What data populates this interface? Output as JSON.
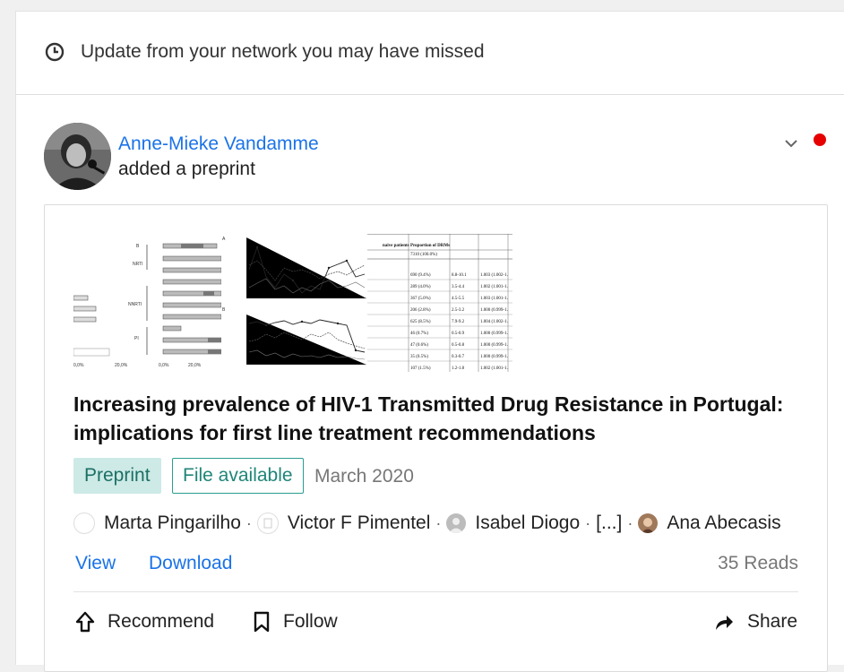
{
  "header": {
    "text": "Update from your network you may have missed",
    "icon": "clock-icon"
  },
  "post": {
    "author_name": "Anne-Mieke Vandamme",
    "action": "added a preprint",
    "unread_color": "#e60000"
  },
  "publication": {
    "title": "Increasing prevalence of HIV-1 Transmitted Drug Resistance in Portugal: implications for first line treatment recommendations",
    "type_badge": "Preprint",
    "file_badge": "File available",
    "date": "March 2020",
    "authors": [
      {
        "name": "Marta Pingarilho"
      },
      {
        "name": "Victor F Pimentel"
      },
      {
        "name": "Isabel Diogo"
      },
      {
        "name": "[...]"
      },
      {
        "name": "Ana Abecasis"
      }
    ],
    "view_label": "View",
    "download_label": "Download",
    "reads": "35 Reads"
  },
  "thumbnail_table": {
    "header": [
      "Proportion of DRMs"
    ],
    "rows": [
      [
        "7310 (100.0%)",
        "",
        ""
      ],
      [
        "690 (9.4%)",
        "8.8-10.1",
        "1.003 (1.002-1."
      ],
      [
        "289 (4.0%)",
        "3.5-4.4",
        "1.002 (1.001-1."
      ],
      [
        "367 (5.0%)",
        "4.5-5.5",
        "1.003 (1.001-1."
      ],
      [
        "206 (2.8%)",
        "2.5-3.2",
        "1.000 (0.999-1."
      ],
      [
        "625 (8.5%)",
        "7.9-9.2",
        "1.004 (1.002-1."
      ],
      [
        "46 (0.7%)",
        "0.5-0.9",
        "1.000 (0.999-1."
      ],
      [
        "47 (0.6%)",
        "0.5-0.8",
        "1.000 (0.999-1."
      ],
      [
        "35 (0.5%)",
        "0.3-0.7",
        "1.000 (0.999-1."
      ],
      [
        "107 (1.5%)",
        "1.2-1.8",
        "1.002 (1.001-1."
      ]
    ]
  },
  "actions": {
    "recommend": "Recommend",
    "follow": "Follow",
    "share": "Share"
  }
}
